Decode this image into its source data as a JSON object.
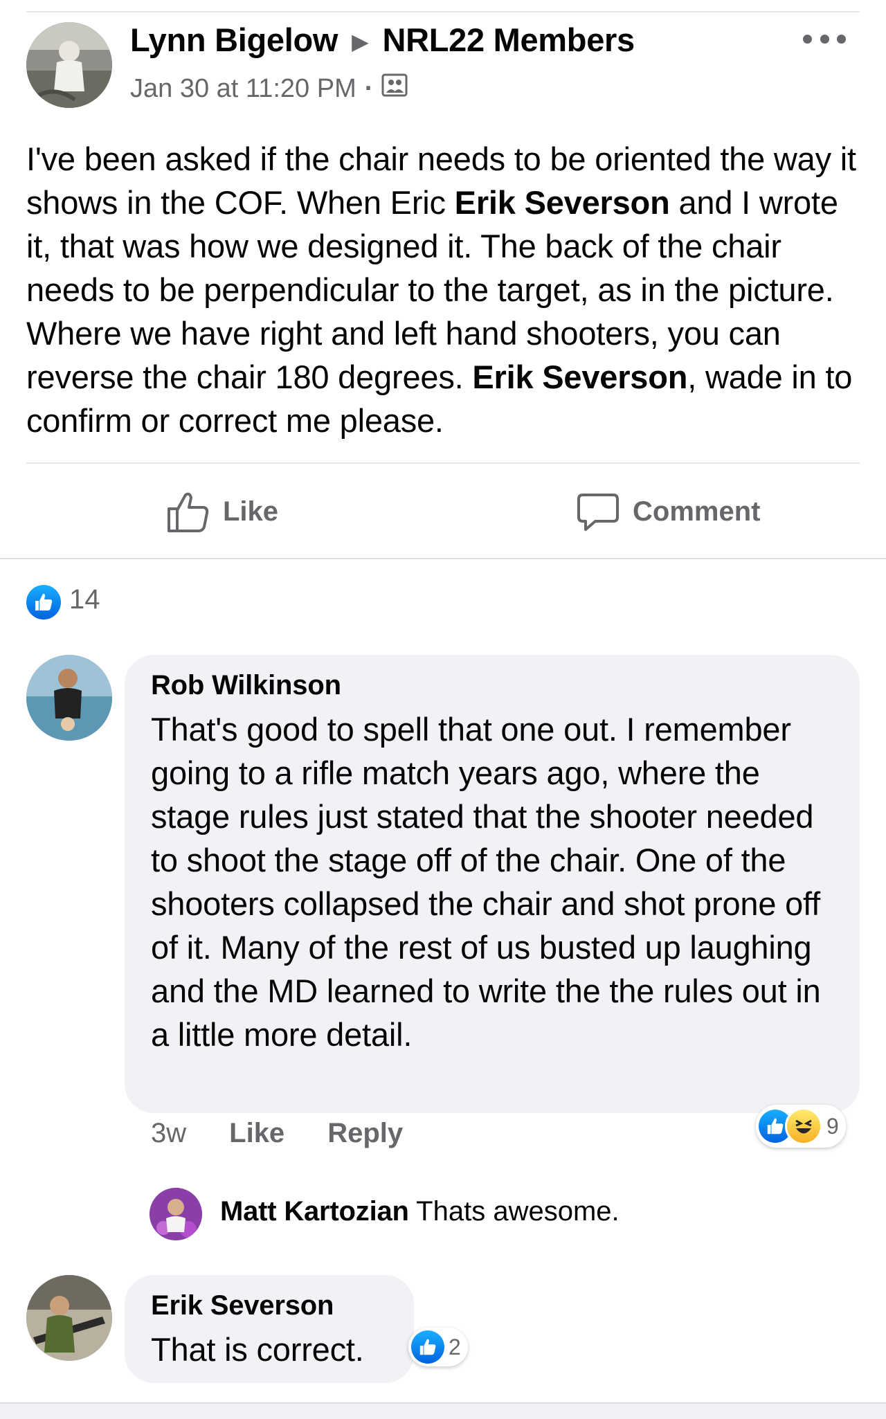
{
  "post": {
    "author": "Lynn Bigelow",
    "group": "NRL22 Members",
    "timestamp": "Jan 30 at 11:20 PM",
    "audience_icon": "group-members-icon",
    "body": [
      {
        "text": "I've been asked if the chair needs to be oriented the way it shows in the COF. When Eric ",
        "bold": false
      },
      {
        "text": "Erik Severson",
        "bold": true
      },
      {
        "text": " and I wrote it, that was how we designed it. The back of the chair needs to be perpendicular to the target, as in the picture. Where we have right and left hand shooters, you can reverse the chair 180 degrees. ",
        "bold": false
      },
      {
        "text": "Erik Severson",
        "bold": true
      },
      {
        "text": ", wade in to confirm or correct me please.",
        "bold": false
      }
    ],
    "like_label": "Like",
    "comment_label": "Comment",
    "reaction_count": "14"
  },
  "comments": [
    {
      "author": "Rob Wilkinson",
      "text": "That's good to spell that one out.  I remember going to a rifle match years ago, where the stage rules just stated that the shooter needed to shoot the stage off of the chair.  One of the shooters collapsed the chair and shot prone off of it.  Many of the rest of us busted up laughing and the MD learned to write the the rules out in a little more detail.",
      "time": "3w",
      "like_label": "Like",
      "reply_label": "Reply",
      "reaction_count": "9"
    },
    {
      "author": "Matt Kartozian",
      "text": "Thats awesome."
    },
    {
      "author": "Erik Severson",
      "text": "That is correct.",
      "reaction_count": "2"
    }
  ],
  "colors": {
    "like_blue": "#0866ff",
    "secondary_text": "#65676b",
    "bubble_bg": "#f0f2f5"
  }
}
